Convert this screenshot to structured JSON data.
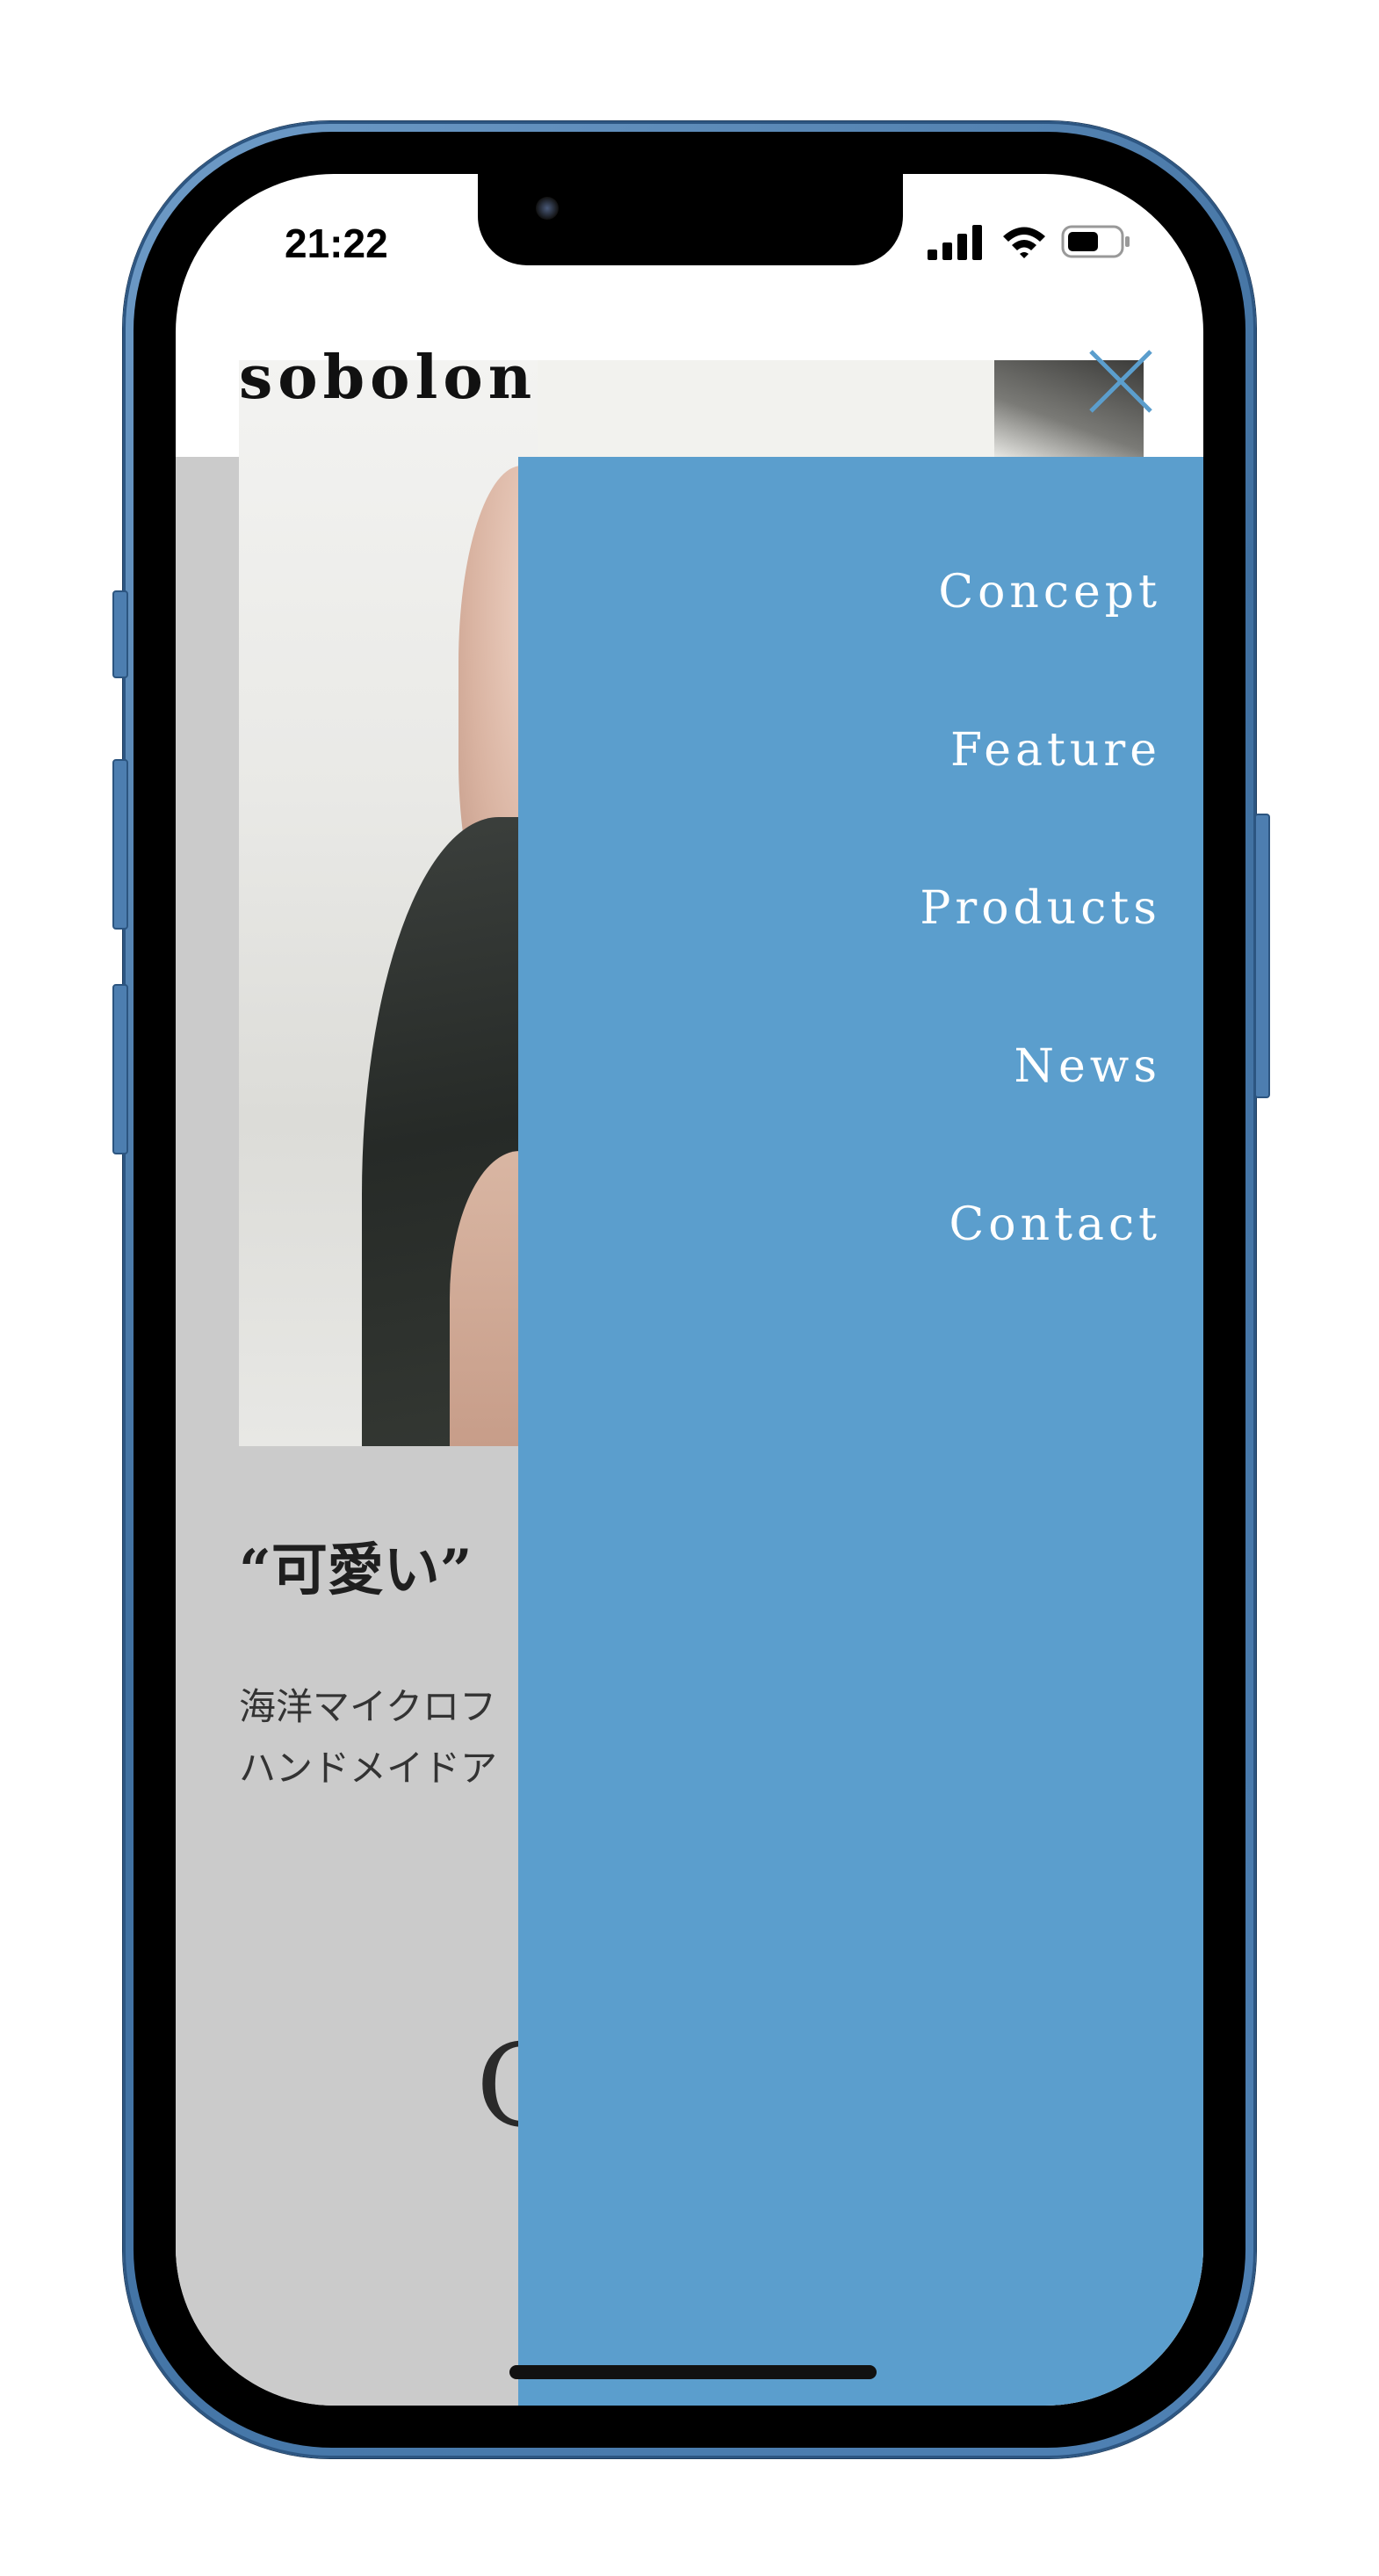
{
  "status_bar": {
    "time": "21:22",
    "icons": [
      "signal-icon",
      "wifi-icon",
      "battery-icon"
    ]
  },
  "header": {
    "logo": "sobolon",
    "close_icon": "close-icon"
  },
  "menu": {
    "background_color": "#5b9ecd",
    "items": [
      {
        "label": "Concept"
      },
      {
        "label": "Feature"
      },
      {
        "label": "Products"
      },
      {
        "label": "News"
      },
      {
        "label": "Contact"
      }
    ]
  },
  "page": {
    "headline": "“可愛い”",
    "body_lines": [
      "海洋マイクロフ",
      "ハンドメイドア"
    ],
    "section_letter": "C"
  },
  "colors": {
    "accent": "#5b9ecd",
    "page_overlay": "#cbcbcb",
    "phone_frame": "#4f81b4"
  }
}
